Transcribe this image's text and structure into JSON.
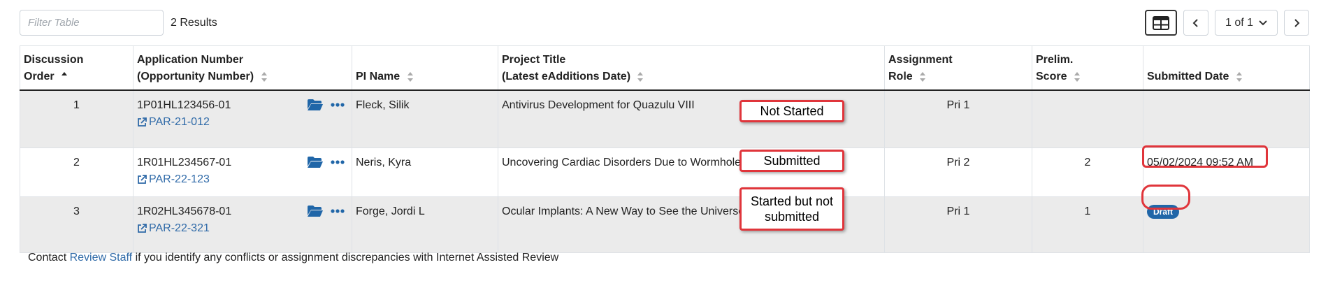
{
  "toolbar": {
    "filter_placeholder": "Filter Table",
    "results_text": "2 Results",
    "page_label": "1 of 1"
  },
  "table": {
    "columns": [
      {
        "line1": "Discussion",
        "line2": "Order",
        "sort": "asc"
      },
      {
        "line1": "Application Number",
        "line2": "(Opportunity Number)",
        "sort": "none"
      },
      {
        "line1": "",
        "line2": "PI Name",
        "sort": "none"
      },
      {
        "line1": "Project Title",
        "line2": "(Latest eAdditions Date)",
        "sort": "none"
      },
      {
        "line1": "Assignment",
        "line2": "Role",
        "sort": "none"
      },
      {
        "line1": "Prelim.",
        "line2": "Score",
        "sort": "none"
      },
      {
        "line1": "",
        "line2": "Submitted Date",
        "sort": "none"
      }
    ],
    "rows": [
      {
        "order": "1",
        "app_number": "1P01HL123456-01",
        "opportunity": "PAR-21-012",
        "pi": "Fleck, Silik",
        "title": "Antivirus Development for Quazulu VIII",
        "role": "Pri 1",
        "score": "",
        "submitted": ""
      },
      {
        "order": "2",
        "app_number": "1R01HL234567-01",
        "opportunity": "PAR-22-123",
        "pi": "Neris, Kyra",
        "title": "Uncovering Cardiac Disorders Due to Wormhole Proximity",
        "role": "Pri 2",
        "score": "2",
        "submitted": "05/02/2024 09:52 AM"
      },
      {
        "order": "3",
        "app_number": "1R02HL345678-01",
        "opportunity": "PAR-22-321",
        "pi": "Forge, Jordi L",
        "title": "Ocular Implants: A New Way to See the Universe",
        "role": "Pri 1",
        "score": "1",
        "submitted_badge": "Draft"
      }
    ]
  },
  "callouts": {
    "not_started": "Not Started",
    "submitted": "Submitted",
    "started_not_submitted": "Started but not submitted"
  },
  "footer": {
    "prefix": "Contact",
    "link": "Review Staff",
    "suffix": "if you identify any conflicts or assignment discrepancies with Internet Assisted Review"
  },
  "colors": {
    "link": "#2f6aa8",
    "icon": "#2066a8",
    "callout_border": "#e0353b",
    "row_shade": "#ebebeb",
    "badge": "#2066a8"
  },
  "icons": [
    "table-view-icon",
    "chevron-left-icon",
    "chevron-down-icon",
    "chevron-right-icon",
    "folder-open-icon",
    "more-options-icon",
    "external-link-icon",
    "sort-icon"
  ]
}
